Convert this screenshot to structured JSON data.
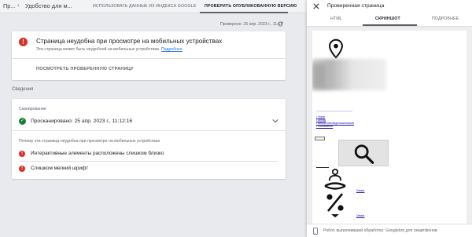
{
  "breadcrumb": {
    "parent": "Пр...",
    "current": "Удобство для м..."
  },
  "tabs": [
    {
      "label": "ИСПОЛЬЗОВАТЬ ДАННЫЕ ИЗ ИНДЕКСА GOOGLE",
      "active": false
    },
    {
      "label": "ПРОВЕРИТЬ ОПУБЛИКОВАННУЮ ВЕРСИЮ",
      "active": true
    }
  ],
  "checked_at": "Проверено: 25 апр. 2023 г., 11:12",
  "error_card": {
    "title": "Страница неудобна при просмотре на мобильных устройствах",
    "subtitle": "Эта страница может быть неудобной на мобильных устройствах.",
    "details_link": "Подробнее",
    "view_button": "ПОСМОТРЕТЬ ПРОВЕРЕННУЮ СТРАНИЦУ"
  },
  "details": {
    "section_label": "Сведения",
    "crawl_caption": "Сканирование",
    "crawl_status": "Просканировано: 25 апр. 2023 г., 11:12:16",
    "why_label": "Почему эта страница неудобна при просмотре на мобильных устройствах",
    "issues": [
      "Интерактивные элементы расположены слишком близко",
      "Слишком мелкий шрифт"
    ]
  },
  "panel": {
    "title": "Проверенная страница",
    "tabs": [
      {
        "label": "HTML",
        "active": false
      },
      {
        "label": "СКРИНШОТ",
        "active": true
      },
      {
        "label": "ПОДРОБНЕЕ",
        "active": false
      }
    ],
    "screenshot": {
      "links": [
        "Home",
        "Antrag",
        "Besuch Berufsgenossenschaft",
        "Kontaktieren"
      ],
      "side_links": [
        "Details",
        "Details"
      ]
    },
    "footer": "Робот, выполнивший обработку: Googlebot для смартфонов"
  },
  "colors": {
    "error": "#d93025",
    "success": "#188038",
    "link": "#1a73e8",
    "background": "#e8eaee",
    "tab_indicator": "#5f6368"
  }
}
